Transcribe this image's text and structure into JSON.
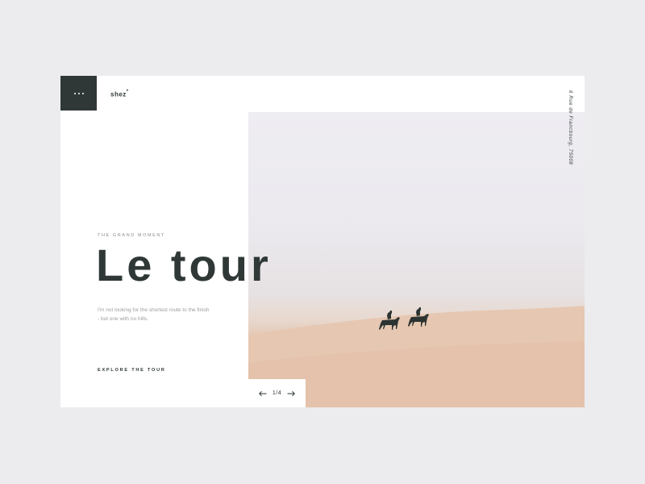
{
  "brand": {
    "name": "shez",
    "mark": "*"
  },
  "menu": {
    "icon": "dots-menu-icon"
  },
  "address": "6 Rue de Francbourg, 75008",
  "hero": {
    "eyebrow": "THE GRAND MOMENT",
    "title": "Le tour",
    "description": "I'm not looking for the shortest route to the finish - but one with no hills.",
    "cta": "EXPLORE THE TOUR",
    "image": "desert-horse-riders"
  },
  "pager": {
    "current": "1/4",
    "prev_icon": "arrow-left-icon",
    "next_icon": "arrow-right-icon"
  },
  "colors": {
    "background": "#ecebee",
    "card": "#ffffff",
    "dark": "#2f3836",
    "sand": "#e3c2ac"
  }
}
